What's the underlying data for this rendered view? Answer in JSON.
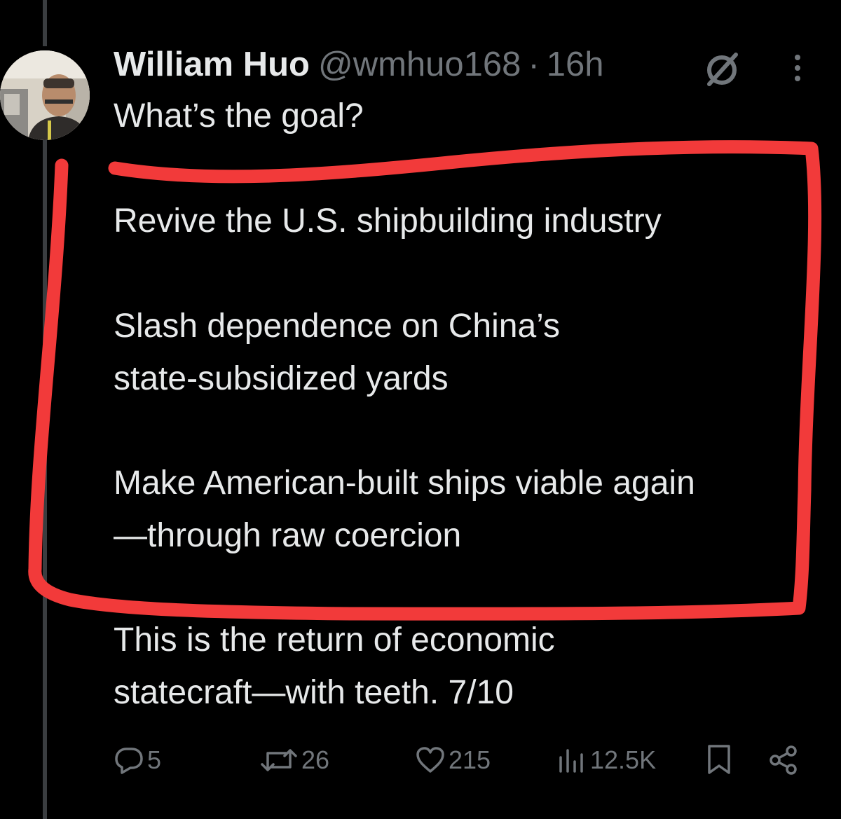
{
  "tweet": {
    "author_name": "William Huo",
    "handle": "@wmhuo168",
    "separator": "·",
    "time": "16h",
    "lines": [
      "What’s the goal?",
      "Revive the U.S. shipbuilding industry",
      "Slash dependence on China’s",
      "state-subsidized yards",
      "Make American-built ships viable again",
      "—through raw coercion",
      "This is the return of economic",
      "statecraft—with teeth. 7/10"
    ]
  },
  "actions": {
    "replies": "5",
    "reposts": "26",
    "likes": "215",
    "views": "12.5K"
  },
  "icons": {
    "grok": "grok-icon",
    "more": "more-icon",
    "reply": "reply-icon",
    "repost": "repost-icon",
    "like": "heart-icon",
    "views": "views-icon",
    "bookmark": "bookmark-icon",
    "share": "share-icon"
  },
  "colors": {
    "background": "#000000",
    "text": "#e7e9ea",
    "secondary": "#71767b",
    "annotation": "#f23a3a"
  }
}
